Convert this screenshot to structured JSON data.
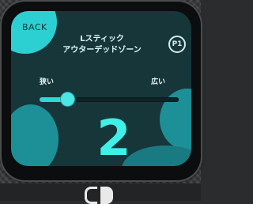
{
  "header": {
    "back_label": "BACK",
    "title_line1": "Lスティック",
    "title_line2": "アウターデッドゾーン",
    "player_badge": "P1"
  },
  "slider": {
    "min_label": "狭い",
    "max_label": "広い",
    "position_fraction": 0.2
  },
  "value": "2",
  "icons": {
    "console_logo": "switch-logo-icon"
  },
  "colors": {
    "accent": "#2dd0d2",
    "value_text": "#3ef0e8",
    "screen_bg": "#16363a"
  }
}
